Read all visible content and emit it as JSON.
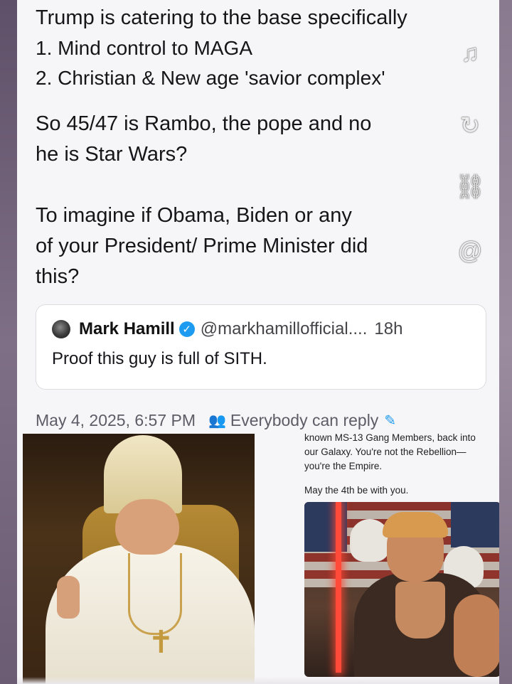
{
  "post": {
    "lines": [
      "Trump is catering to the base specifically",
      "1. Mind control to MAGA",
      "2. Christian & New age 'savior complex'",
      "So 45/47 is Rambo, the pope and no",
      "he is Star Wars?",
      "To imagine if Obama, Biden or any",
      "of your President/ Prime Minister did",
      "this?"
    ]
  },
  "side_icons": [
    "music-note-icon",
    "sync-icon",
    "link-chain-icon",
    "at-sign-icon"
  ],
  "quote": {
    "name": "Mark Hamill",
    "verified": true,
    "handle": "@markhamillofficial....",
    "time": "18h",
    "body": "Proof this guy is full of SITH."
  },
  "meta": {
    "timestamp": "May 4, 2025, 6:57 PM",
    "reply_setting": "Everybody can reply"
  },
  "screenshot_text": {
    "lines": [
      "known MS-13 Gang Members, back into",
      "our Galaxy. You're not the Rebellion—",
      "you're the Empire.",
      "May the 4th be with you."
    ]
  },
  "colors": {
    "background": "#f6f5f7",
    "text": "#16151a",
    "muted": "#5e5c66",
    "verified_blue": "#1d9bf0",
    "frame": "#7a6a82"
  }
}
